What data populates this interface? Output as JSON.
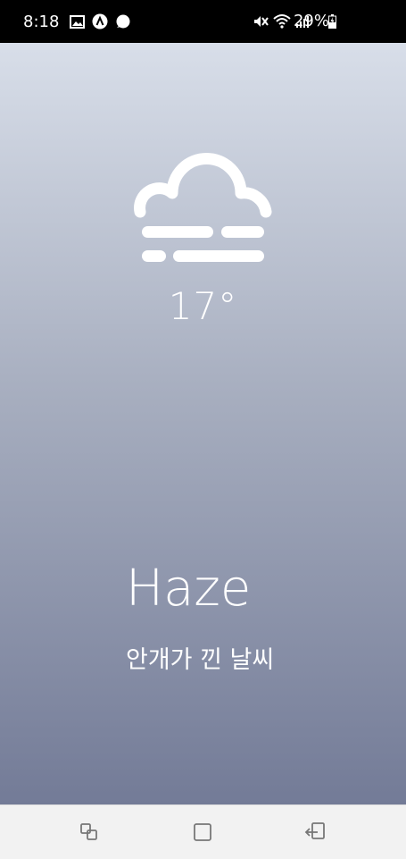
{
  "status_bar": {
    "time": "8:18",
    "battery": "29%",
    "icons": [
      "gallery-icon",
      "vpn-icon",
      "message-icon",
      "mute-icon",
      "wifi-icon",
      "signal-icon",
      "battery-charging-icon"
    ]
  },
  "weather": {
    "icon": "haze-cloud-icon",
    "temperature": "17°",
    "condition": "Haze",
    "description": "안개가 낀 날씨"
  },
  "nav_bar": {
    "items": [
      "recent-apps-icon",
      "home-icon",
      "back-icon"
    ]
  },
  "colors": {
    "gradient_top": "#d8dee9",
    "gradient_bottom": "#737b97",
    "text": "#ffffff",
    "nav_background": "#f2f2f2"
  }
}
